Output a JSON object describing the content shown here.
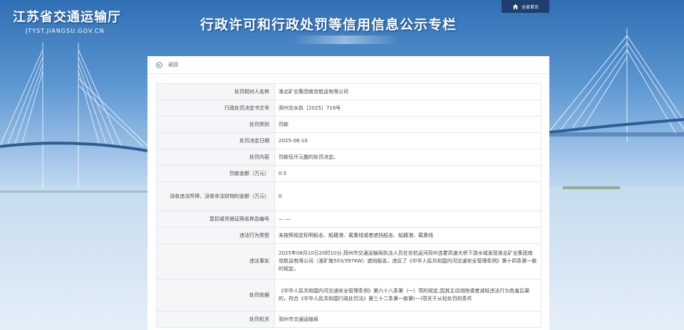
{
  "header": {
    "logo_cn": "江苏省交通运输厅",
    "logo_en": "JTYST.JIANGSU.GOV.CN",
    "banner_title": "行政许可和行政处罚等信用信息公示专栏",
    "home_link": "全省首页",
    "home_icon": "home-icon"
  },
  "toolbar": {
    "back_label": "返回",
    "back_icon": "back-arrow-icon"
  },
  "detail": {
    "rows": [
      {
        "label": "处罚相对人名称",
        "value": "淮北矿业集团南京航运有限公司"
      },
      {
        "label": "行政处罚决定书文号",
        "value": "邳州交水执［2025］718号"
      },
      {
        "label": "处罚类别",
        "value": "罚款"
      },
      {
        "label": "处罚决定日期",
        "value": "2025-08-10"
      },
      {
        "label": "处罚内容",
        "value": "罚款伍仟元整的处罚决定。"
      },
      {
        "label": "罚款金额（万元）",
        "value": "0.5"
      },
      {
        "label": "没收违法所得、没收非法财物的金额（万元）",
        "value": "0"
      },
      {
        "label": "暂扣或吊销证照名称及编号",
        "value": "— —"
      },
      {
        "label": "违法行为类型",
        "value": "未按照规定标明船名、船籍港、载重线或者遮挡船名、船籍港、载重线"
      },
      {
        "label": "违法事实",
        "value": "2025年08月10日20时10分,邳州市交通运输局执法人员在京杭运河邳州连霍高速大桥下游水域发现淮北矿业集团南京航运有限公司（淮矿拖503/397KW）遮挡船名，违反了《中华人民共和国内河交通安全管理条例》第十四条第一款的规定。"
      },
      {
        "label": "处罚依据",
        "value": "《中华人民共和国内河交通安全管理条例》第六十八条第（一）项的规定,因其主动消除或者减轻违法行为危害后果的，符合《中华人民共和国行政处罚法》第三十二条第一款第(一)项关于从轻处罚的条件"
      },
      {
        "label": "处罚机关",
        "value": "邳州市交通运输局"
      }
    ]
  }
}
